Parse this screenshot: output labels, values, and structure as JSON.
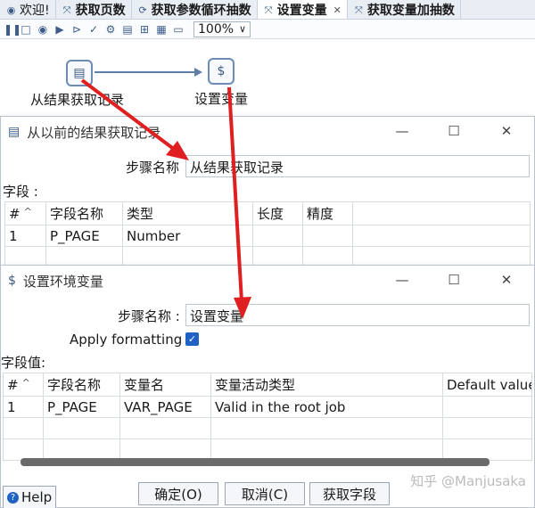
{
  "tabs": [
    {
      "label": "欢迎!",
      "icon": "spoon-icon"
    },
    {
      "label": "获取页数",
      "icon": "transformation-icon"
    },
    {
      "label": "获取参数循环抽数",
      "icon": "job-icon"
    },
    {
      "label": "设置变量",
      "icon": "transformation-icon",
      "active": true
    },
    {
      "label": "获取变量加抽数",
      "icon": "transformation-icon"
    }
  ],
  "toolbar": {
    "zoom": "100%"
  },
  "canvas": {
    "steps": [
      {
        "label": "从结果获取记录",
        "icon": "table-icon"
      },
      {
        "label": "设置变量",
        "icon": "dollar-icon"
      }
    ]
  },
  "dialog_result": {
    "title": "从以前的结果获取记录",
    "step_name_label": "步骤名称",
    "step_name_value": "从结果获取记录",
    "fields_label": "字段 :",
    "columns": [
      "#",
      "字段名称",
      "类型",
      "长度",
      "精度"
    ],
    "rows": [
      [
        "1",
        "P_PAGE",
        "Number",
        "",
        ""
      ]
    ]
  },
  "dialog_setvar": {
    "title": "设置环境变量",
    "step_name_label": "步骤名称 :",
    "step_name_value": "设置变量",
    "apply_formatting_label": "Apply formatting",
    "apply_formatting_checked": true,
    "field_values_label": "字段值:",
    "columns": [
      "#",
      "字段名称",
      "变量名",
      "变量活动类型",
      "Default value"
    ],
    "rows": [
      [
        "1",
        "P_PAGE",
        "VAR_PAGE",
        "Valid in the root job",
        ""
      ]
    ],
    "buttons": {
      "help": "Help",
      "ok": "确定(O)",
      "cancel": "取消(C)",
      "get_fields": "获取字段"
    }
  },
  "watermark": "知乎 @Manjusaka",
  "colors": {
    "annotation_arrow": "#e02020",
    "accent": "#1f62c3",
    "hop": "#5f7ea8"
  }
}
